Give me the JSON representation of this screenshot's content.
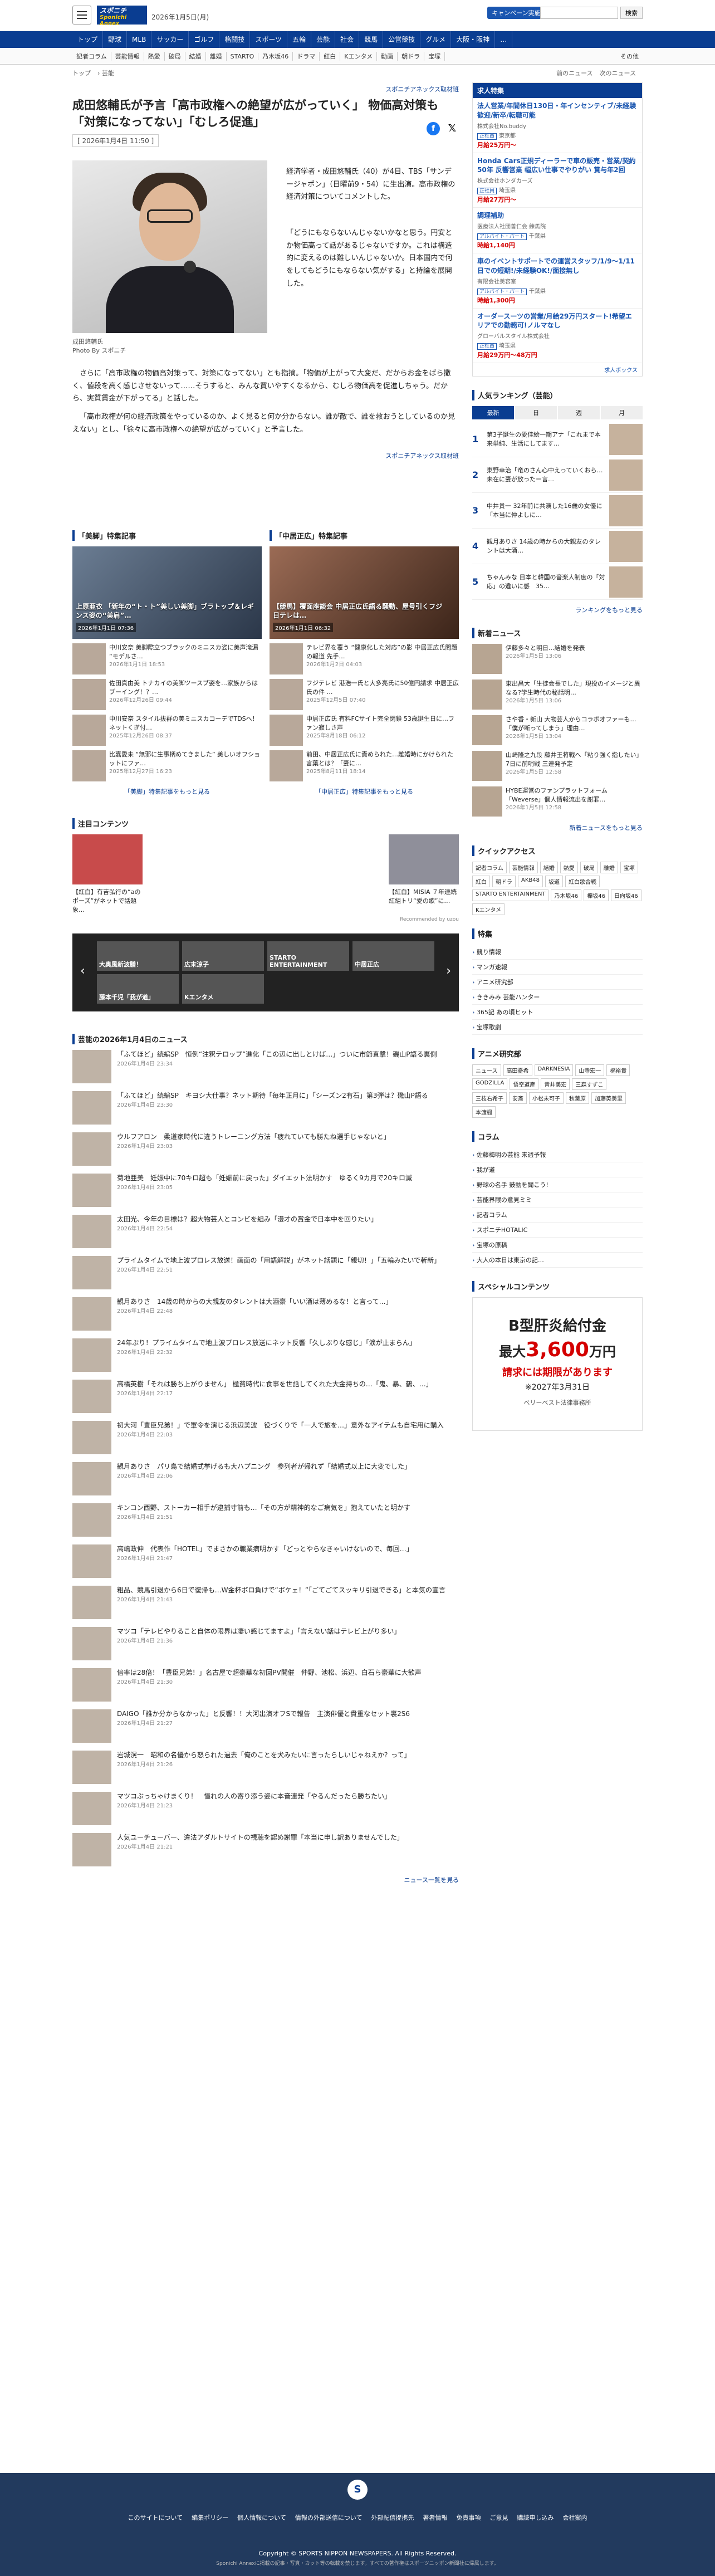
{
  "header": {
    "logo_main": "スポニチ",
    "logo_sub": "Sponichi Annex",
    "date": "2026年1月5日(月)",
    "campaign": "キャンペーン実施中!",
    "search_btn": "検索"
  },
  "nav": [
    "トップ",
    "野球",
    "MLB",
    "サッカー",
    "ゴルフ",
    "格闘技",
    "スポーツ",
    "五輪",
    "芸能",
    "社会",
    "競馬",
    "公営競技",
    "グルメ",
    "大阪・阪神",
    "…"
  ],
  "subnav": [
    "記者コラム",
    "芸能情報",
    "熱愛",
    "破局",
    "結婚",
    "離婚",
    "STARTO",
    "乃木坂46",
    "ドラマ",
    "紅白",
    "Kエンタメ",
    "動画",
    "朝ドラ",
    "宝塚",
    "その他"
  ],
  "crumb": {
    "a": "トップ",
    "b": "芸能",
    "prev": "前のニュース",
    "next": "次のニュース"
  },
  "article": {
    "sponsor": "スポニチアネックス取材班",
    "headline": "成田悠輔氏が予言「高市政権への絶望が広がっていく」 物価高対策も「対策になってない」「むしろ促進」",
    "pubdate": "[ 2026年1月4日 11:50 ]",
    "p1": "経済学者・成田悠輔氏（40）が4日、TBS「サンデージャポン」（日曜前9・54）に生出演。高市政権の経済対策についてコメントした。",
    "p2": "「どうにもならないんじゃないかなと思う。円安とか物価高って話があるじゃないですか。これは構造的に変えるのは難しいんじゃないか。日本国内で何をしてもどうにもならない気がする」と持論を展開した。",
    "p3": "さらに「高市政権の物価高対策って、対策になってない」とも指摘。「物価が上がって大変だ、だからお金をばら撒く、値段を高く感じさせないって……そうすると、みんな買いやすくなるから、むしろ物価高を促進しちゃう。だから、実質賃金が下がってる」と話した。",
    "p4": "「高市政権が何の経済政策をやっているのか、よく見ると何か分からない。誰が敵で、誰を救おうとしているのか見えない」とし、「徐々に高市政権への絶望が広がっていく」と予言した。",
    "caption": "成田悠輔氏",
    "caption2": "Photo By スポニチ",
    "src": "スポニチアネックス取材班"
  },
  "feature": {
    "left_title": "「美脚」特集記事",
    "right_title": "「中居正広」特集記事",
    "left_big": "上原亜衣 「新年の“ト・ト”美しい美脚」ブラトップ＆レギンス姿の“美肩”…",
    "left_big_date": "2026年1月1日 07:36",
    "right_big": "【競馬】覆面座談会 中居正広氏語る騒動、屋号引くフジ 日テレは…",
    "right_big_date": "2026年1月1日 06:32",
    "left_items": [
      {
        "t": "中川安奈 美脚際立つブラックのミニスカ姿に美声滝漏 “モデルさ…",
        "d": "2026年1月1日 18:53"
      },
      {
        "t": "佐田真由美 トナカイの美脚ツースブ姿を…家族からはブーイング！？…",
        "d": "2026年12月26日 09:44"
      },
      {
        "t": "中川安奈 スタイル抜群の美ミニスカコーデでTDSへ！ネットくぎ付…",
        "d": "2025年12月26日 08:37"
      },
      {
        "t": "比嘉愛未 “無邪に生事柄めてきました” 美しいオフショットにファ…",
        "d": "2025年12月27日 16:23"
      }
    ],
    "right_items": [
      {
        "t": "テレビ界を覆う “健康化した対応”の影 中居正広氏問題の報道 先手…",
        "d": "2026年1月2日 04:03"
      },
      {
        "t": "フジテレビ 港浩一氏と大多亮氏に50億円請求 中居正広氏の件 …",
        "d": "2025年12月5日 07:40"
      },
      {
        "t": "中居正広氏 有料FCサイト完全閉鎖 53歳誕生日に…ファン寂しさ声",
        "d": "2025年8月18日 06:12"
      },
      {
        "t": "前田、中居正広氏に責められた…離婚時にかけられた言葉とは？「妻に…",
        "d": "2025年8月11日 18:14"
      }
    ],
    "left_more": "「美脚」特集記事をもっと見る",
    "right_more": "「中居正広」特集記事をもっと見る"
  },
  "notable": {
    "title": "注目コンテンツ",
    "a": "【紅白】有吉弘行の“aのポーズ”がネットで話題　象…",
    "b": "【紅白】MISIA ７年連続紅組トリ“愛の歌”に…",
    "credit": "Recommended by uzou"
  },
  "banner": [
    "大奥風新波膳！",
    "広末涼子",
    "STARTO ENTERTAINMENT",
    "中居正広",
    "藤本千児「我が道」",
    "Kエンタメ"
  ],
  "newslist": {
    "title": "芸能の2026年1月4日のニュース",
    "more": "ニュース一覧を見る",
    "items": [
      {
        "t": "「ふてほど」続編SP　恒例“注釈テロップ”進化「この辺に出しとけば…」ついに市節直撃！磯山P語る裏側",
        "d": "2026年1月4日 23:34"
      },
      {
        "t": "「ふてほど」続編SP　キヨシ大仕事？ネット期待「毎年正月に」「シーズン2有石」第3弾は？磯山P語る",
        "d": "2026年1月4日 23:30"
      },
      {
        "t": "ウルフアロン　柔道家時代に違うトレーニング方法「疲れていても勝たね選手じゃないと」",
        "d": "2026年1月4日 23:03"
      },
      {
        "t": "菊地亜美　妊娠中に70キロ超も「妊娠前に戻った」ダイエット法明かす　ゆるく9カ月で20キロ減",
        "d": "2026年1月4日 23:05"
      },
      {
        "t": "太田光、今年の目標は？超大物芸人とコンビを組み「漫才の賞金で日本中を回りたい」",
        "d": "2026年1月4日 22:54"
      },
      {
        "t": "プライムタイムで地上波プロレス放送！画面の「用語解説」がネット話題に「親切！」「五輪みたいで斬新」",
        "d": "2026年1月4日 22:51"
      },
      {
        "t": "観月ありさ　14歳の時からの大親友のタレントは大酒豪「いい酒は薄めるな！と言って…」",
        "d": "2026年1月4日 22:48"
      },
      {
        "t": "24年ぶり！プライムタイムで地上波プロレス放送にネット反響「久しぶりな感じ」「涙が止まらん」",
        "d": "2026年1月4日 22:32"
      },
      {
        "t": "高橋英樹「それは勝ち上がりません」 極貧時代に食事を世話してくれた大金持ちの…「鬼、暴、鶴、…」",
        "d": "2026年1月4日 22:17"
      },
      {
        "t": "初大河「豊臣兄弟！」で軍令を演じる浜辺美波　役づくりで「一人で旅を…」意外なアイテムも自宅用に購入",
        "d": "2026年1月4日 22:03"
      },
      {
        "t": "観月ありさ　パリ島で結婚式挙げるも大ハプニング　参列者が帰れず「結婚式以上に大変でした」",
        "d": "2026年1月4日 22:06"
      },
      {
        "t": "キンコン西野、ストーカー相手が逮捕寸前も…「その方が精神的なご病気を」抱えていたと明かす",
        "d": "2026年1月4日 21:51"
      },
      {
        "t": "高嶋政伸　代表作「HOTEL」でまさかの職業病明かす「どっとやらなきゃいけないので、毎回…」",
        "d": "2026年1月4日 21:47"
      },
      {
        "t": "粗品、競馬引退から6日で復帰も…W金杯ボロ負けで“ボケェ！”「ごてごてスッキリ引退できる」と本気の宣言",
        "d": "2026年1月4日 21:43"
      },
      {
        "t": "マツコ「テレビやりること自体の限界は凄い感じてますよ」「言えない話はテレビ上がり多い」",
        "d": "2026年1月4日 21:36"
      },
      {
        "t": "倍率は28倍！「豊臣兄弟！」名古屋で超豪華な初回PV開催　仲野、池松、浜辺、白石ら豪華に大歓声",
        "d": "2026年1月4日 21:30"
      },
      {
        "t": "DAIGO「誰か分からなかった」と反響！！大河出演オフSで報告　主演俳優と貴重なセット裏2S6",
        "d": "2026年1月4日 21:27"
      },
      {
        "t": "岩城滉一　昭和の名優から怒られた過去「俺のことを犬みたいに言ったらしいじゃねえか？って」",
        "d": "2026年1月4日 21:26"
      },
      {
        "t": "マツコぶっちゃけまくり！　憧れの人の寄り添う姿に本音連発「やるんだったら勝ちたい」",
        "d": "2026年1月4日 21:23"
      },
      {
        "t": "人気ユーチューバー、違法アダルトサイトの視聴を認め謝罪「本当に申し訳ありませんでした」",
        "d": "2026年1月4日 21:21"
      }
    ]
  },
  "jobs": {
    "title": "求人特集",
    "items": [
      {
        "t": "法人営業/年間休日130日・年インセンティブ/未経験歓迎/新卒/転職可能",
        "co": "株式会社No.buddy",
        "loc": "東京都",
        "tag": "正社員",
        "pay": "月給25万円〜"
      },
      {
        "t": "Honda Cars正規ディーラーで車の販売・営業/契約50年 反響営業 幅広い仕事でやりがい 賞与年2回",
        "co": "株式会社ホンダカーズ",
        "loc": "埼玉県",
        "tag": "正社員",
        "pay": "月給27万円〜"
      },
      {
        "t": "調理補助",
        "co": "医療法人社団善仁会 練馬院",
        "loc": "千葉県",
        "tag": "アルバイト・パート",
        "pay": "時給1,140円"
      },
      {
        "t": "車のイベントサポートでの運営スタッフ/1/9〜1/11日での短期!/未経験OK!/面接無し",
        "co": "有限会社美容室",
        "loc": "千葉県",
        "tag": "アルバイト・パート",
        "pay": "時給1,300円"
      },
      {
        "t": "オーダースーツの営業/月給29万円スタート!希望エリアでの勤務可!ノルマなし",
        "co": "グローバルスタイル株式会社",
        "loc": "埼玉県",
        "tag": "正社員",
        "pay": "月給29万円〜48万円"
      }
    ],
    "credit": "求人ボックス"
  },
  "ranking": {
    "title": "人気ランキング（芸能）",
    "tabs": [
      "最新",
      "日",
      "週",
      "月"
    ],
    "items": [
      "第3子誕生の愛佳絵一期アナ「これまで本来単純、生活にしてます…",
      "東野幸治「竜のさん心中えっていくおら…未在に妻が放ったー言…",
      "中井貴一 32年前に共演した16歳の女優に「本当に仲よしに…",
      "観月ありさ 14歳の時からの大親友のタレントは大酒…",
      "ちゃんみな 日本と韓国の音楽人制度の「対応」の違いに感　35…"
    ],
    "more": "ランキングをもっと見る"
  },
  "sidenews": {
    "title": "新着ニュース",
    "items": [
      {
        "t": "伊藤多々と明日...結婚を発表",
        "d": "2026年1月5日 13:06"
      },
      {
        "t": "東出昌大「生徒会長でした」現役のイメージと異なる?学生時代の秘話明…",
        "d": "2026年1月5日 13:06"
      },
      {
        "t": "さや香・新山 大物芸人からコラボオファーも…「僕が断ってしまう」理由…",
        "d": "2026年1月5日 13:04"
      },
      {
        "t": "山崎隆之九段 藤井王将戦へ「粘り強く指したい」7日に前哨戦 三連発予定",
        "d": "2026年1月5日 12:58"
      },
      {
        "t": "HYBE運営のファンプラットフォーム「Weverse」個人情報流出を謝罪…",
        "d": "2026年1月5日 12:58"
      }
    ],
    "more": "新着ニュースをもっと見る"
  },
  "quick": {
    "title": "クイックアクセス",
    "chips": [
      "記者コラム",
      "芸能情報",
      "結婚",
      "熱愛",
      "破局",
      "離婚",
      "宝塚",
      "紅白",
      "朝ドラ",
      "AKB48",
      "坂道",
      "紅白歌合戦",
      "STARTO ENTERTAINMENT",
      "乃木坂46",
      "欅坂46",
      "日向坂46",
      "Kエンタメ"
    ]
  },
  "special": {
    "title": "特集",
    "items": [
      "競り情報",
      "マンガ速報",
      "アニメ研究部",
      "ききみみ 芸能ハンター",
      "365記 あの頃ヒット",
      "宝塚歌劇"
    ]
  },
  "anime": {
    "title": "アニメ研究部",
    "chips": [
      "ニュース",
      "高田憂希",
      "DARKNESIA",
      "山寺宏一",
      "梶裕貴",
      "GODZILLA",
      "悟空道産",
      "青井美宏",
      "三森すずこ",
      "三枝右希子",
      "安斎",
      "小松未可子",
      "秋葉原",
      "加藤英美里",
      "本渡楓"
    ]
  },
  "column": {
    "title": "コラム",
    "items": [
      "佐藤梅明の芸能 来週予報",
      "我が道",
      "野球の名手 鼓動を聞こう!",
      "芸能界隈の意見ミミ",
      "記者コラム",
      "スポニチHOTALIC",
      "宝塚の原稿",
      "大人の本日は東京の記…"
    ]
  },
  "spcontent": {
    "title": "スペシャルコンテンツ"
  },
  "adbox": {
    "a1": "B型肝炎給付金",
    "a2pre": "最大",
    "a2num": "3,600",
    "a2suf": "万円",
    "a3": "請求には期限があります",
    "a4": "※2027年3月31日",
    "a5": "ベリーベスト法律事務所"
  },
  "footer": {
    "links": [
      "このサイトについて",
      "編集ポリシー",
      "個人情報について",
      "情報の外部送信について",
      "外部配信提携先",
      "著者情報",
      "免責事項",
      "ご意見",
      "購読申し込み",
      "会社案内"
    ],
    "copy": "Copyright © SPORTS NIPPON NEWSPAPERS. All Rights Reserved.",
    "copy2": "Sponichi Annexに掲載の記事・写真・カット等の転載を禁じます。すべての著作権はスポーツニッポン新聞社に帰属します。",
    "logo": "S"
  }
}
